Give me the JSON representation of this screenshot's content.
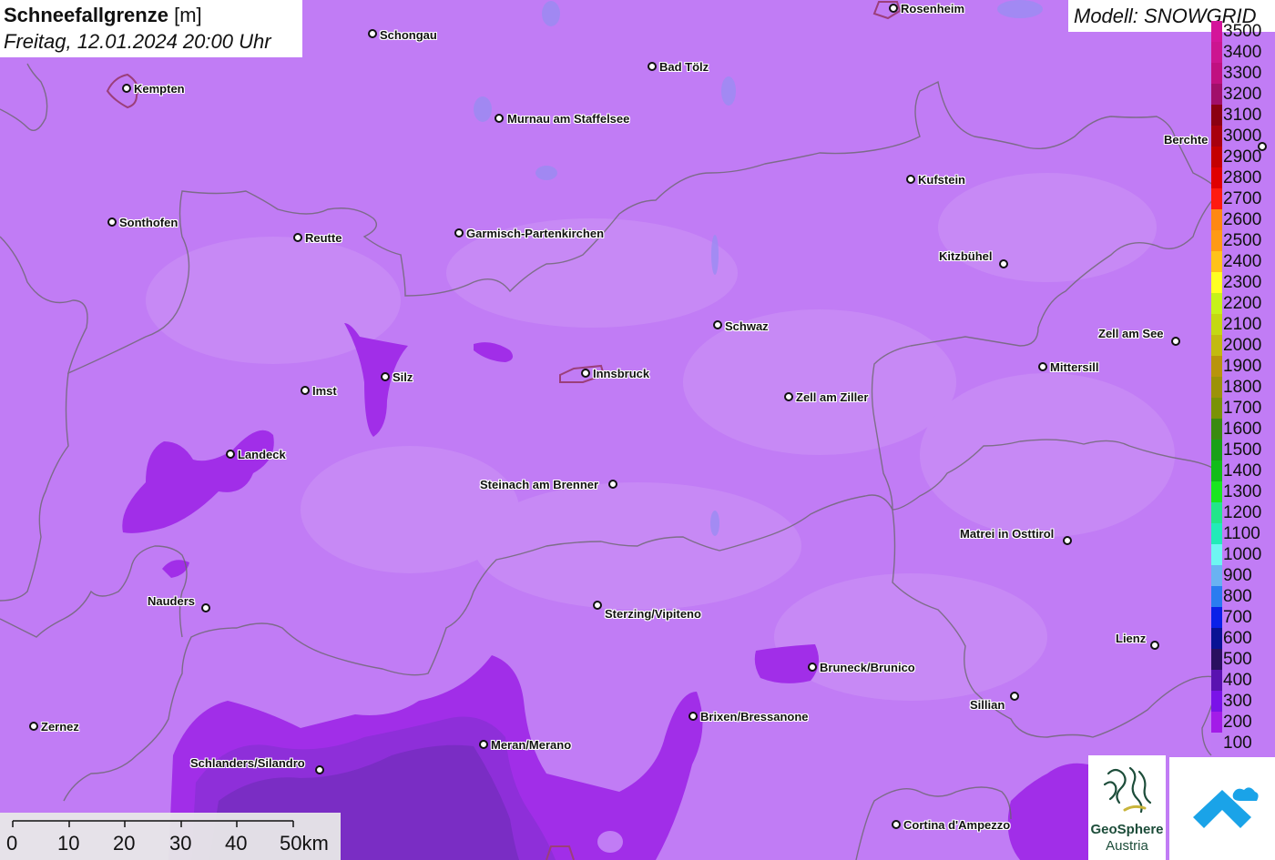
{
  "title": {
    "main": "Schneefallgrenze",
    "unit": "[m]",
    "subtitle": "Freitag, 12.01.2024 20:00 Uhr"
  },
  "model_label": "Modell: SNOWGRID",
  "legend": [
    {
      "label": "3500",
      "color": "#d4159a"
    },
    {
      "label": "3400",
      "color": "#cc1590"
    },
    {
      "label": "3300",
      "color": "#c01080"
    },
    {
      "label": "3200",
      "color": "#a10f6a"
    },
    {
      "label": "3100",
      "color": "#8b0012"
    },
    {
      "label": "3000",
      "color": "#a8000e"
    },
    {
      "label": "2900",
      "color": "#c40000"
    },
    {
      "label": "2800",
      "color": "#e00000"
    },
    {
      "label": "2700",
      "color": "#ff1a10"
    },
    {
      "label": "2600",
      "color": "#ff8811"
    },
    {
      "label": "2500",
      "color": "#ff9a14"
    },
    {
      "label": "2400",
      "color": "#ffc21a"
    },
    {
      "label": "2300",
      "color": "#ffff22"
    },
    {
      "label": "2200",
      "color": "#c6f21a"
    },
    {
      "label": "2100",
      "color": "#c4d812"
    },
    {
      "label": "2000",
      "color": "#c2ba10"
    },
    {
      "label": "1900",
      "color": "#b8940c"
    },
    {
      "label": "1800",
      "color": "#9c9208"
    },
    {
      "label": "1700",
      "color": "#7a9206"
    },
    {
      "label": "1600",
      "color": "#3a8a10"
    },
    {
      "label": "1500",
      "color": "#1aa018"
    },
    {
      "label": "1400",
      "color": "#12bc1a"
    },
    {
      "label": "1300",
      "color": "#1ae620"
    },
    {
      "label": "1200",
      "color": "#22e68a"
    },
    {
      "label": "1100",
      "color": "#22ebb8"
    },
    {
      "label": "1000",
      "color": "#6ef6f2"
    },
    {
      "label": "900",
      "color": "#6ab2f2"
    },
    {
      "label": "800",
      "color": "#2a7cf0"
    },
    {
      "label": "700",
      "color": "#0a20e8"
    },
    {
      "label": "600",
      "color": "#0a1294"
    },
    {
      "label": "500",
      "color": "#2a1060"
    },
    {
      "label": "400",
      "color": "#5a12b0"
    },
    {
      "label": "300",
      "color": "#7a12e8"
    },
    {
      "label": "200",
      "color": "#a31ce8"
    },
    {
      "label": "100",
      "color": "#c07cf5"
    }
  ],
  "cities": [
    {
      "name": "Rosenheim"
    },
    {
      "name": "Schongau"
    },
    {
      "name": "Bad Tölz"
    },
    {
      "name": "Kempten"
    },
    {
      "name": "Murnau am Staffelsee"
    },
    {
      "name": "Berchte"
    },
    {
      "name": "Kufstein"
    },
    {
      "name": "Sonthofen"
    },
    {
      "name": "Reutte"
    },
    {
      "name": "Garmisch-Partenkirchen"
    },
    {
      "name": "Kitzbühel"
    },
    {
      "name": "Schwaz"
    },
    {
      "name": "Zell am See"
    },
    {
      "name": "Silz"
    },
    {
      "name": "Innsbruck"
    },
    {
      "name": "Mittersill"
    },
    {
      "name": "Imst"
    },
    {
      "name": "Zell am Ziller"
    },
    {
      "name": "Landeck"
    },
    {
      "name": "Steinach am Brenner"
    },
    {
      "name": "Matrei in Osttirol"
    },
    {
      "name": "Nauders"
    },
    {
      "name": "Sterzing/Vipiteno"
    },
    {
      "name": "Lienz"
    },
    {
      "name": "Bruneck/Brunico"
    },
    {
      "name": "Sillian"
    },
    {
      "name": "Brixen/Bressanone"
    },
    {
      "name": "Zernez"
    },
    {
      "name": "Meran/Merano"
    },
    {
      "name": "Schlanders/Silandro"
    },
    {
      "name": "Cortina d'Ampezzo"
    }
  ],
  "scale_bar": [
    "0",
    "10",
    "20",
    "30",
    "40",
    "50km"
  ],
  "logos": {
    "geosphere_line1": "GeoSphere",
    "geosphere_line2": "Austria"
  }
}
